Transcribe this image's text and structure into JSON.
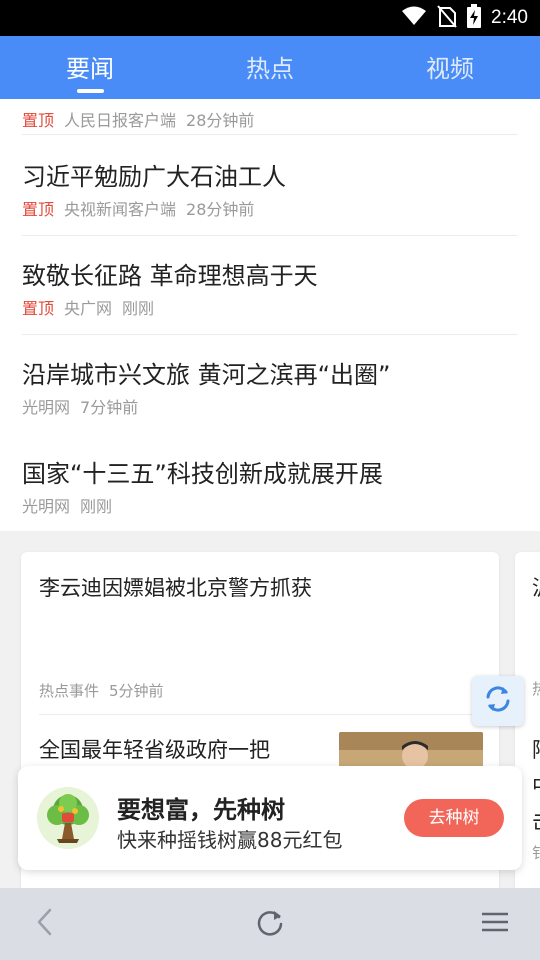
{
  "status_bar": {
    "time": "2:40"
  },
  "tabs": [
    {
      "label": "要闻",
      "active": true
    },
    {
      "label": "热点",
      "active": false
    },
    {
      "label": "视频",
      "active": false
    }
  ],
  "news": [
    {
      "title": "",
      "pinned": true,
      "pin_label": "置顶",
      "source": "人民日报客户端",
      "time": "28分钟前"
    },
    {
      "title": "习近平勉励广大石油工人",
      "pinned": true,
      "pin_label": "置顶",
      "source": "央视新闻客户端",
      "time": "28分钟前"
    },
    {
      "title": "致敬长征路 革命理想高于天",
      "pinned": true,
      "pin_label": "置顶",
      "source": "央广网",
      "time": "刚刚"
    },
    {
      "title": "沿岸城市兴文旅 黄河之滨再“出圈”",
      "pinned": false,
      "pin_label": "",
      "source": "光明网",
      "time": "7分钟前"
    },
    {
      "title": "国家“十三五”科技创新成就展开展",
      "pinned": false,
      "pin_label": "",
      "source": "光明网",
      "time": "刚刚"
    }
  ],
  "hot_card": {
    "headline": "李云迪因嫖娼被北京警方抓获",
    "category": "热点事件",
    "time": "5分钟前",
    "second_headline": "全国最年轻省级政府一把"
  },
  "next_card_peek": [
    "沪",
    "热",
    "阿",
    "中",
    "击",
    "钅"
  ],
  "promo": {
    "title": "要想富，先种树",
    "subtitle": "快来种摇钱树赢88元红包",
    "button": "去种树"
  },
  "colors": {
    "tab_bar": "#4a8cf7",
    "pin": "#e24a3b",
    "promo_button": "#f2665a",
    "refresh_icon": "#3b86e0",
    "bottom_nav": "#dadde3"
  },
  "icons": {
    "status": [
      "wifi-icon",
      "no-sim-icon",
      "battery-charging-icon"
    ],
    "float": "refresh-icon",
    "promo": "money-tree-icon",
    "nav": [
      "back-icon",
      "reload-icon",
      "menu-icon"
    ]
  }
}
